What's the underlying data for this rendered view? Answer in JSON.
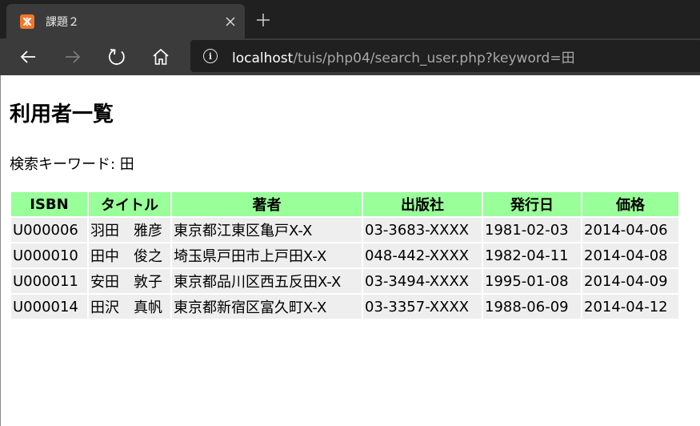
{
  "browser": {
    "tab_title": "課題２",
    "url_host": "localhost",
    "url_rest": "/tuis/php04/search_user.php?keyword=田"
  },
  "page": {
    "title": "利用者一覧",
    "keyword_label": "検索キーワード: 田"
  },
  "table": {
    "headers": [
      "ISBN",
      "タイトル",
      "著者",
      "出版社",
      "発行日",
      "価格"
    ],
    "rows": [
      [
        "U000006",
        "羽田　雅彦",
        "東京都江東区亀戸X-X",
        "03-3683-XXXX",
        "1981-02-03",
        "2014-04-06"
      ],
      [
        "U000010",
        "田中　俊之",
        "埼玉県戸田市上戸田X-X",
        "048-442-XXXX",
        "1982-04-11",
        "2014-04-08"
      ],
      [
        "U000011",
        "安田　敦子",
        "東京都品川区西五反田X-X",
        "03-3494-XXXX",
        "1995-01-08",
        "2014-04-09"
      ],
      [
        "U000014",
        "田沢　真帆",
        "東京都新宿区富久町X-X",
        "03-3357-XXXX",
        "1988-06-09",
        "2014-04-12"
      ]
    ]
  },
  "icons": {
    "favicon": "xampp-icon",
    "close": "close-icon",
    "new_tab": "plus-icon",
    "back": "back-arrow-icon",
    "forward": "forward-arrow-icon",
    "refresh": "refresh-icon",
    "home": "home-icon",
    "info": "info-icon"
  },
  "colors": {
    "header_bg": "#99ff99",
    "cell_bg": "#eeeeee",
    "tab_favicon": "#f0772b"
  }
}
